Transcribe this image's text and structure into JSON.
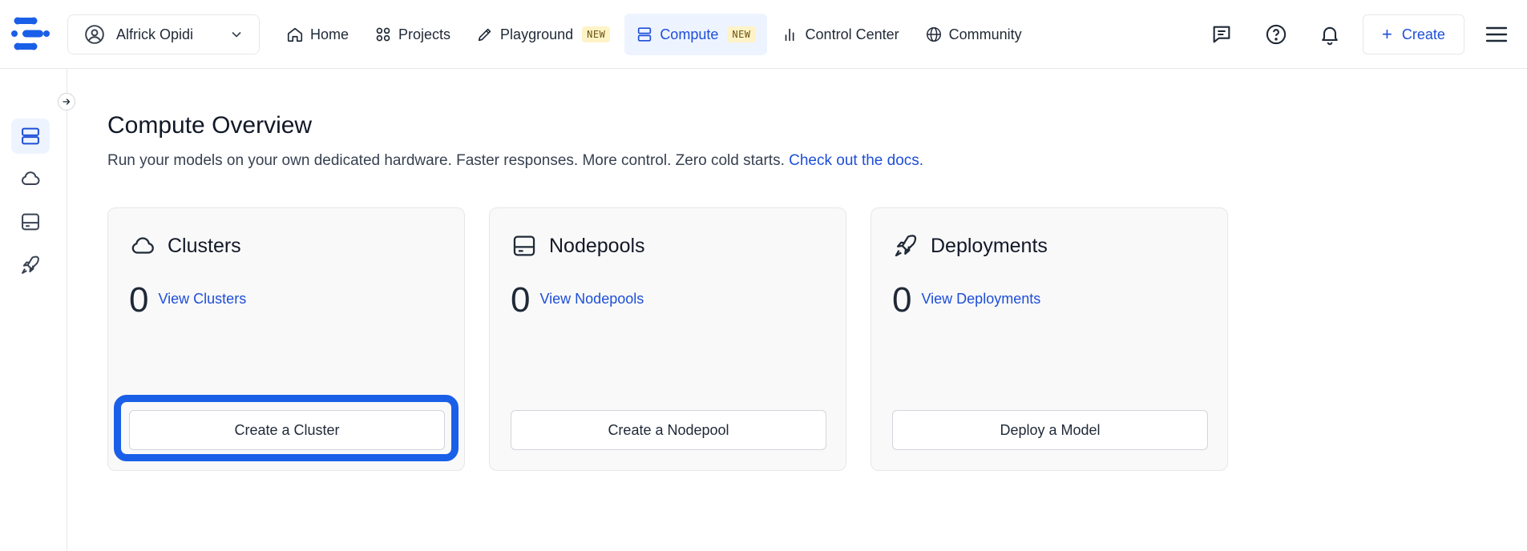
{
  "header": {
    "user_name": "Alfrick Opidi",
    "nav": [
      {
        "label": "Home"
      },
      {
        "label": "Projects"
      },
      {
        "label": "Playground",
        "badge": "NEW"
      },
      {
        "label": "Compute",
        "badge": "NEW",
        "active": true
      },
      {
        "label": "Control Center"
      },
      {
        "label": "Community"
      }
    ],
    "create_label": "Create",
    "icons": [
      "chat-icon",
      "help-icon",
      "bell-icon",
      "menu-icon"
    ]
  },
  "sidebar": {
    "items": [
      "server-icon",
      "cloud-icon",
      "drive-icon",
      "rocket-icon"
    ],
    "active": "server-icon"
  },
  "main": {
    "title": "Compute Overview",
    "description": "Run your models on your own dedicated hardware. Faster responses. More control. Zero cold starts.",
    "docs_link": "Check out the docs.",
    "cards": [
      {
        "title": "Clusters",
        "count": "0",
        "link": "View Clusters",
        "button": "Create a Cluster",
        "icon": "cloud-icon"
      },
      {
        "title": "Nodepools",
        "count": "0",
        "link": "View Nodepools",
        "button": "Create a Nodepool",
        "icon": "drive-icon"
      },
      {
        "title": "Deployments",
        "count": "0",
        "link": "View Deployments",
        "button": "Deploy a Model",
        "icon": "rocket-icon"
      }
    ]
  },
  "colors": {
    "accent": "#1d4ed8",
    "highlight": "#1a5fe8",
    "badge_bg": "#fef3c7"
  }
}
